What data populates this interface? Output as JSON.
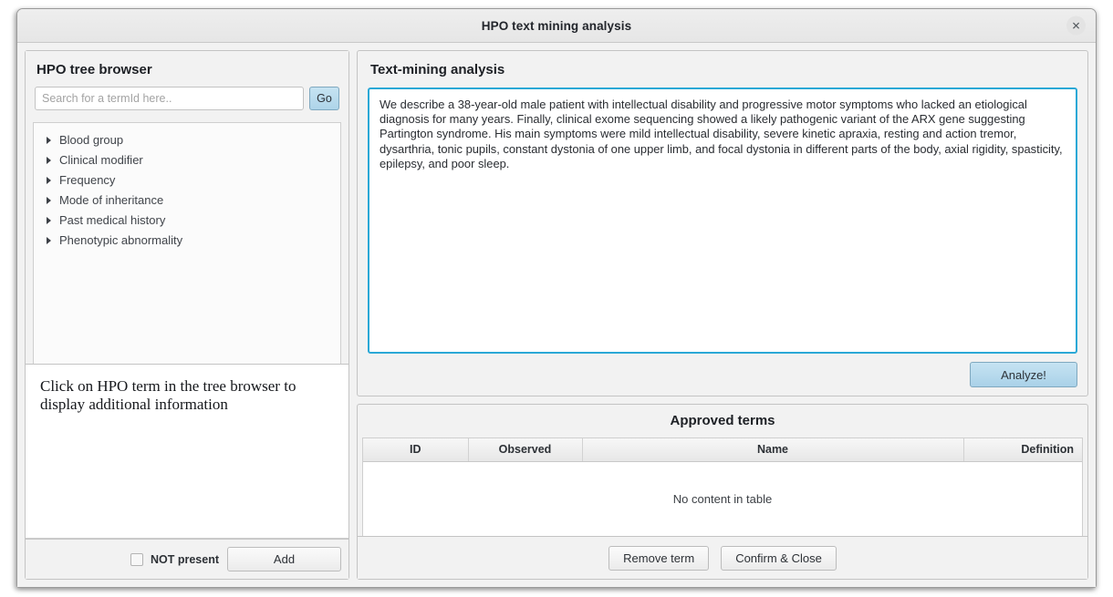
{
  "window": {
    "title": "HPO text mining analysis",
    "close_icon": "close-icon",
    "close_glyph": "✕"
  },
  "left_panel": {
    "heading": "HPO tree browser",
    "search": {
      "placeholder": "Search for a termId here..",
      "value": "",
      "go_label": "Go"
    },
    "tree_items": [
      {
        "label": "Blood group"
      },
      {
        "label": "Clinical modifier"
      },
      {
        "label": "Frequency"
      },
      {
        "label": "Mode of inheritance"
      },
      {
        "label": "Past medical history"
      },
      {
        "label": "Phenotypic abnormality"
      }
    ],
    "info_text": "Click on HPO term in the tree browser to display additional information",
    "footer": {
      "not_present_label": "NOT present",
      "not_present_checked": false,
      "add_label": "Add"
    }
  },
  "right_panel": {
    "text_mining": {
      "heading": "Text-mining analysis",
      "textarea_value": "We describe a 38-year-old male patient with intellectual disability and progressive motor symptoms who lacked an etiological diagnosis for many years. Finally, clinical exome sequencing showed a likely pathogenic variant of the ARX gene suggesting Partington syndrome. His main symptoms were mild intellectual disability, severe kinetic apraxia, resting and action tremor, dysarthria, tonic pupils, constant dystonia of one upper limb, and focal dystonia in different parts of the body, axial rigidity, spasticity, epilepsy, and poor sleep.",
      "analyze_label": "Analyze!"
    },
    "approved_terms": {
      "title": "Approved terms",
      "columns": [
        "ID",
        "Observed",
        "Name",
        "Definition"
      ],
      "rows": [],
      "empty_message": "No content in table",
      "footer": {
        "remove_label": "Remove term",
        "confirm_label": "Confirm & Close"
      }
    }
  },
  "colors": {
    "accent_focus": "#2aa8d6",
    "button_blue": "#b8dcee",
    "window_bg": "#f2f2f2",
    "text": "#2d3136"
  }
}
